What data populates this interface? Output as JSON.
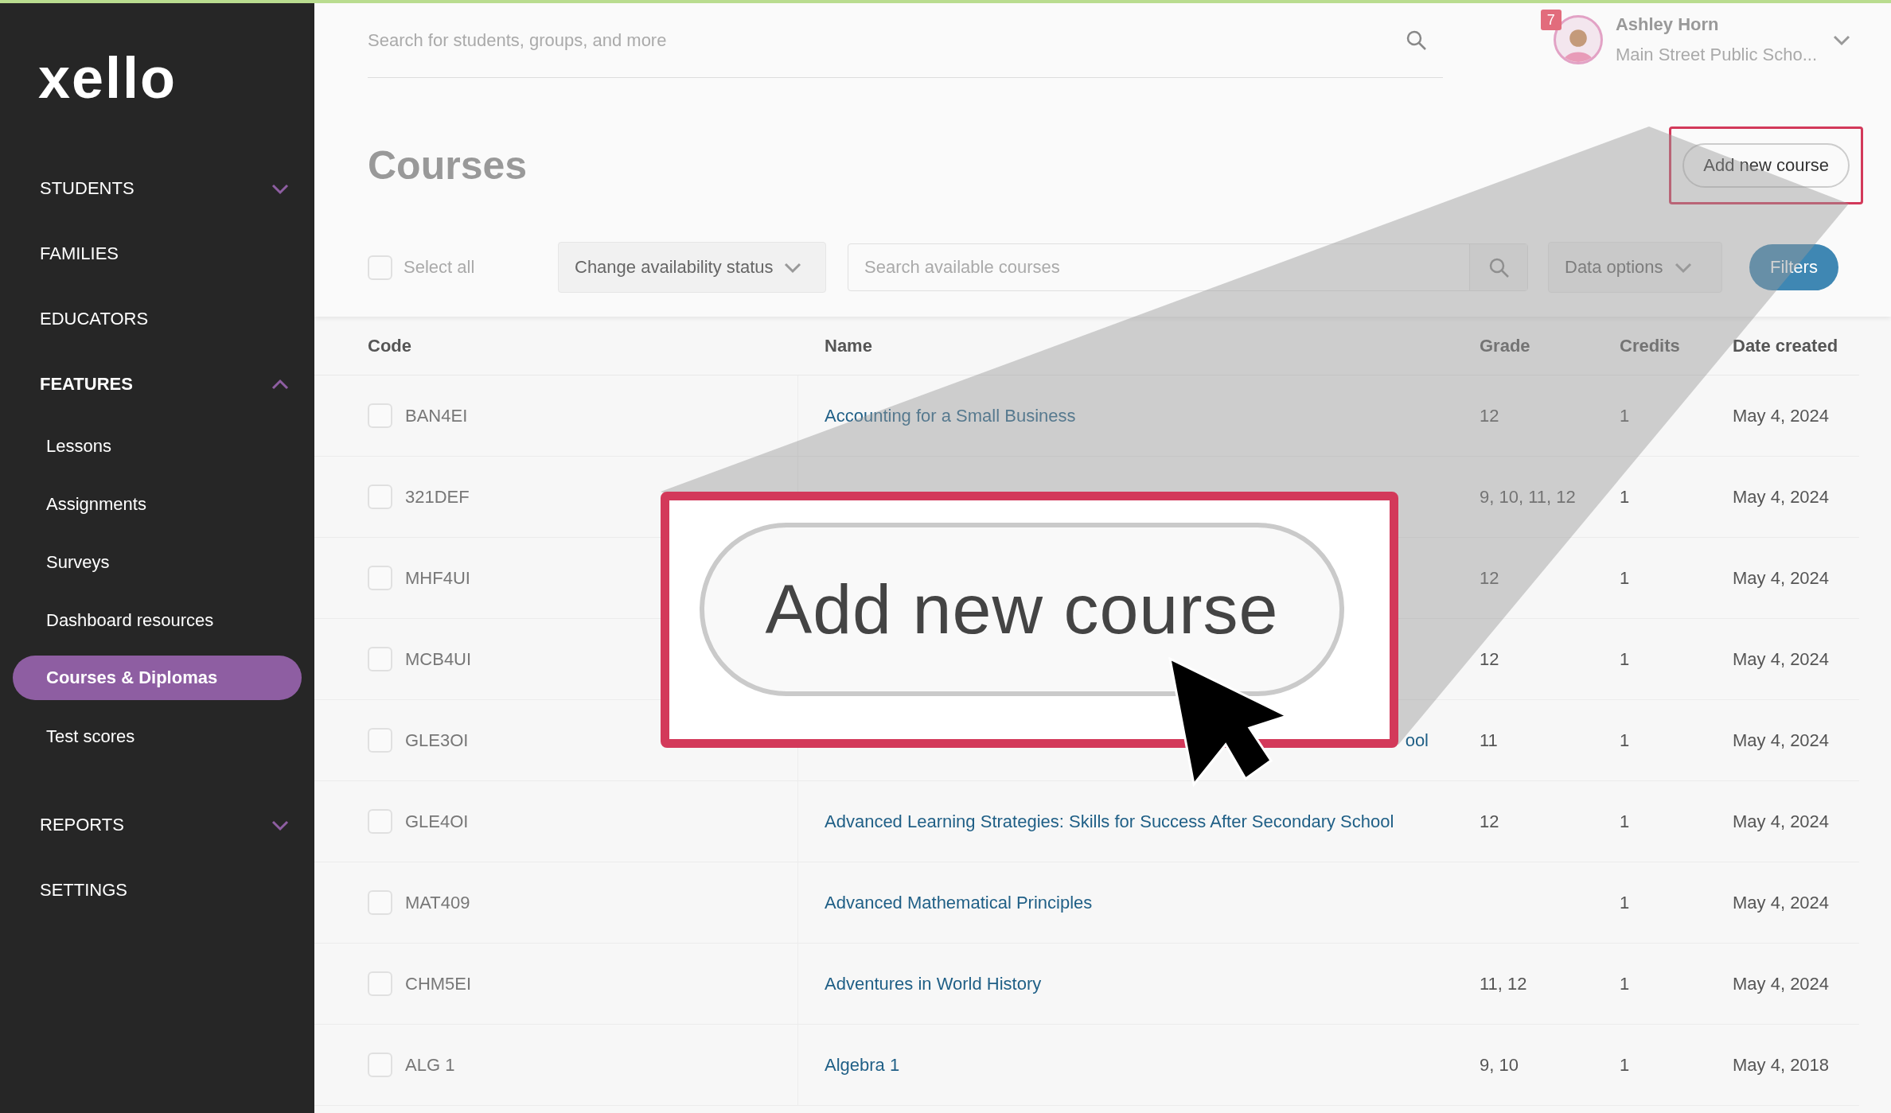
{
  "sidebar": {
    "logo": "xello",
    "items": [
      {
        "label": "STUDENTS",
        "kind": "group",
        "expanded": false,
        "selected": false
      },
      {
        "label": "FAMILIES",
        "kind": "link",
        "selected": false
      },
      {
        "label": "EDUCATORS",
        "kind": "link",
        "selected": false
      },
      {
        "label": "FEATURES",
        "kind": "group",
        "expanded": true,
        "selected": true,
        "children": [
          {
            "label": "Lessons",
            "selected": false
          },
          {
            "label": "Assignments",
            "selected": false
          },
          {
            "label": "Surveys",
            "selected": false
          },
          {
            "label": "Dashboard resources",
            "selected": false
          },
          {
            "label": "Courses & Diplomas",
            "selected": true
          },
          {
            "label": "Test scores",
            "selected": false
          }
        ]
      },
      {
        "label": "REPORTS",
        "kind": "group",
        "expanded": false,
        "selected": false
      },
      {
        "label": "SETTINGS",
        "kind": "link",
        "selected": false
      }
    ]
  },
  "top_bar": {
    "search": {
      "placeholder": "Search for students, groups, and more"
    },
    "user": {
      "name": "Ashley Horn",
      "school": "Main Street Public Scho...",
      "badge": "7"
    }
  },
  "page": {
    "title": "Courses",
    "add_button": {
      "label": "Add new course",
      "highlighted": true
    }
  },
  "toolbar": {
    "select_all": {
      "label": "Select all",
      "checked": false
    },
    "availability_dropdown": "Change availability status",
    "search": {
      "placeholder": "Search available courses"
    },
    "data_options": "Data options",
    "filters_button": "Filters"
  },
  "table": {
    "columns": [
      "Code",
      "Name",
      "Grade",
      "Credits",
      "Date created"
    ],
    "rows": [
      {
        "checked": false,
        "code": "BAN4EI",
        "name": "Accounting for a Small Business",
        "grade": "12",
        "credits": "1",
        "date": "May 4, 2024"
      },
      {
        "checked": false,
        "code": "321DEF",
        "grade": "9, 10, 11, 12",
        "credits": "1",
        "date": "May 4, 2024"
      },
      {
        "checked": false,
        "code": "MHF4UI",
        "grade": "12",
        "credits": "1",
        "date": "May 4, 2024"
      },
      {
        "checked": false,
        "code": "MCB4UI",
        "grade": "12",
        "credits": "1",
        "date": "May 4, 2024"
      },
      {
        "checked": false,
        "code": "GLE3OI",
        "name": "ool",
        "clipped": true,
        "grade": "11",
        "credits": "1",
        "date": "May 4, 2024"
      },
      {
        "checked": false,
        "code": "GLE4OI",
        "name": "Advanced Learning Strategies: Skills for Success After Secondary School",
        "grade": "12",
        "credits": "1",
        "date": "May 4, 2024"
      },
      {
        "checked": false,
        "code": "MAT409",
        "name": "Advanced Mathematical Principles",
        "credits": "1",
        "date": "May 4, 2024"
      },
      {
        "checked": false,
        "code": "CHM5EI",
        "name": "Adventures in World History",
        "grade": "11, 12",
        "credits": "1",
        "date": "May 4, 2024"
      },
      {
        "checked": false,
        "code": "ALG 1",
        "name": "Algebra 1",
        "grade": "9, 10",
        "credits": "1",
        "date": "May 4, 2018"
      }
    ]
  },
  "callout": {
    "label": "Add new course"
  }
}
